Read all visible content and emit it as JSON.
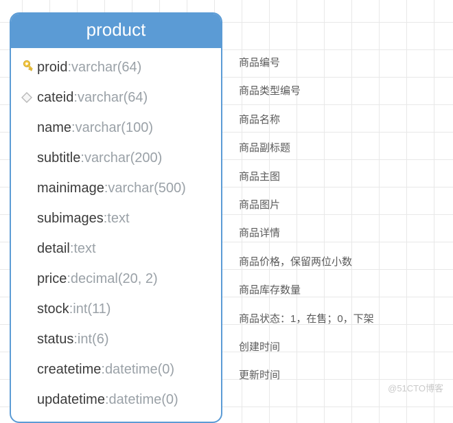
{
  "entity": {
    "name": "product",
    "columns": [
      {
        "name": "proid",
        "type": "varchar(64)",
        "key": "pk",
        "desc": "商品编号"
      },
      {
        "name": "cateid",
        "type": "varchar(64)",
        "key": "fk",
        "desc": "商品类型编号"
      },
      {
        "name": "name",
        "type": "varchar(100)",
        "key": "",
        "desc": "商品名称"
      },
      {
        "name": "subtitle",
        "type": "varchar(200)",
        "key": "",
        "desc": "商品副标题"
      },
      {
        "name": "mainimage",
        "type": "varchar(500)",
        "key": "",
        "desc": "商品主图"
      },
      {
        "name": "subimages",
        "type": "text",
        "key": "",
        "desc": "商品图片"
      },
      {
        "name": "detail",
        "type": "text",
        "key": "",
        "desc": "商品详情"
      },
      {
        "name": "price",
        "type": "decimal(20, 2)",
        "key": "",
        "desc": "商品价格，保留两位小数"
      },
      {
        "name": "stock",
        "type": "int(11)",
        "key": "",
        "desc": "商品库存数量"
      },
      {
        "name": "status",
        "type": "int(6)",
        "key": "",
        "desc": "商品状态：1，在售；0，下架"
      },
      {
        "name": "createtime",
        "type": "datetime(0)",
        "key": "",
        "desc": "创建时间"
      },
      {
        "name": "updatetime",
        "type": "datetime(0)",
        "key": "",
        "desc": "更新时间"
      }
    ]
  },
  "watermark": "@51CTO博客"
}
